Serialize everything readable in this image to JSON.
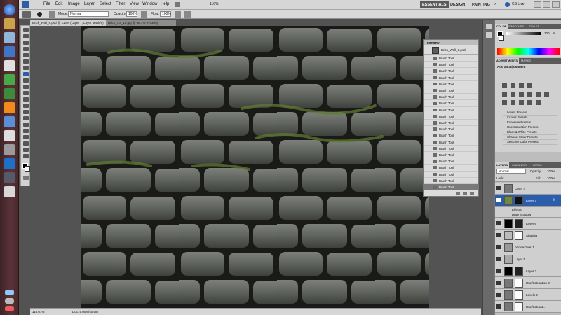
{
  "menubar": {
    "items": [
      "File",
      "Edit",
      "Image",
      "Layer",
      "Select",
      "Filter",
      "View",
      "Window",
      "Help"
    ],
    "zoom": "116%",
    "workspaces": [
      "ESSENTIALS",
      "DESIGN",
      "PAINTING"
    ],
    "more": "»",
    "cslive": "CS Live"
  },
  "options": {
    "mode_label": "Mode:",
    "mode_value": "Normal",
    "opacity_label": "Opacity:",
    "opacity_value": "100%",
    "flow_label": "Flow:",
    "flow_value": "100%"
  },
  "tabs": [
    {
      "label": "Brick_Wall_6.psd @ 116% (Layer 7, Layer Mask/8)"
    },
    {
      "label": "Brick_Tut_10.jpg @ 66.7% (RGB/8)"
    }
  ],
  "status": {
    "zoom": "116.67%",
    "doc": "Doc: 5.00M/40.5M"
  },
  "history": {
    "title": "HISTORY",
    "snapshot": "Brick_Wall_6.psd",
    "steps": [
      "Brush Tool",
      "Brush Tool",
      "Brush Tool",
      "Brush Tool",
      "Brush Tool",
      "Brush Tool",
      "Brush Tool",
      "Brush Tool",
      "Brush Tool",
      "Brush Tool",
      "Brush Tool",
      "Brush Tool",
      "Brush Tool",
      "Brush Tool",
      "Brush Tool",
      "Brush Tool",
      "Brush Tool",
      "Brush Tool",
      "Brush Tool",
      "Brush Tool",
      "Brush Tool"
    ]
  },
  "color_panel": {
    "tabs": [
      "COLOR",
      "SWATCHES",
      "STYLES"
    ],
    "k_value": "100",
    "k_unit": "%"
  },
  "adjustments": {
    "tabs": [
      "ADJUSTMENTS",
      "MASKS"
    ],
    "heading": "Add an adjustment",
    "presets": [
      "Levels Presets",
      "Curves Presets",
      "Exposure Presets",
      "Hue/Saturation Presets",
      "Black & White Presets",
      "Channel Mixer Presets",
      "Selective Color Presets"
    ]
  },
  "layers": {
    "tabs": [
      "LAYERS",
      "CHANNELS",
      "PATHS"
    ],
    "blend_mode": "Normal",
    "opacity_label": "Opacity:",
    "opacity_value": "100%",
    "lock_label": "Lock:",
    "fill_label": "Fill:",
    "fill_value": "100%",
    "effects_label": "Effects",
    "effect_name": "Drop Shadow",
    "items": [
      {
        "name": "Layer 4"
      },
      {
        "name": "Layer 7"
      },
      {
        "name": "Layer 6"
      },
      {
        "name": "Shadow"
      },
      {
        "name": "bricktexture11"
      },
      {
        "name": "Layer 5"
      },
      {
        "name": "Layer 3"
      },
      {
        "name": "Hue/Saturation 3"
      },
      {
        "name": "Levels 2"
      },
      {
        "name": "Hue/Saturati..."
      }
    ]
  },
  "colors": {
    "accent": "#2b5dab",
    "moss": "#6e8a3a"
  }
}
